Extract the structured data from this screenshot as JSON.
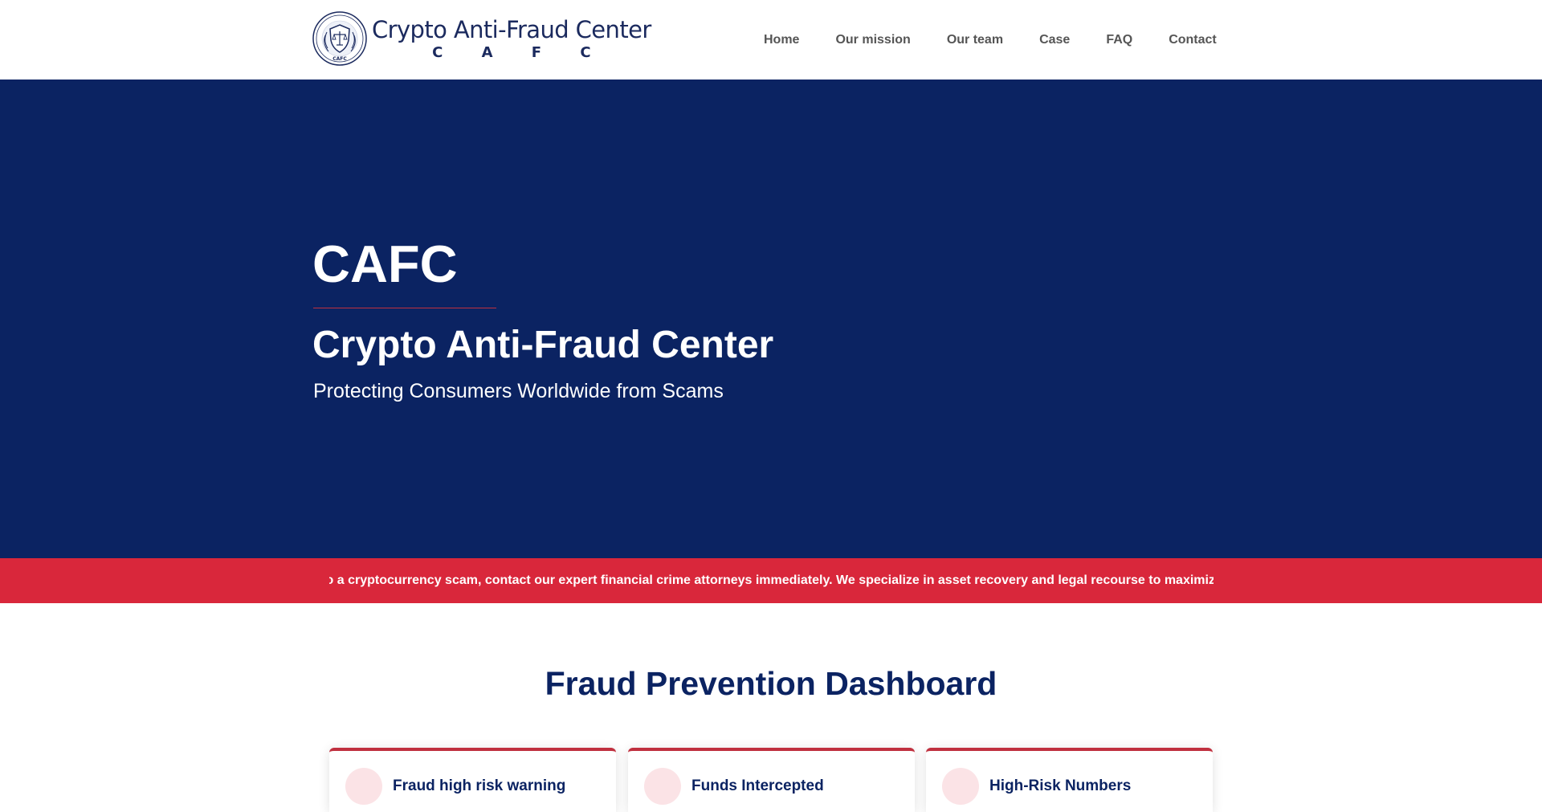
{
  "header": {
    "logo": {
      "title": "Crypto Anti-Fraud Center",
      "abbreviation": "C A F C",
      "seal_text": "CAFC"
    },
    "nav": [
      "Home",
      "Our mission",
      "Our team",
      "Case",
      "FAQ",
      "Contact"
    ]
  },
  "hero": {
    "title": "CAFC",
    "subtitle": "Crypto Anti-Fraud Center",
    "tagline": "Protecting Consumers Worldwide from Scams"
  },
  "ticker": {
    "text": "n to a cryptocurrency scam, contact our expert financial crime attorneys immediately. We specialize in asset recovery and legal recourse to maximize"
  },
  "dashboard": {
    "title": "Fraud Prevention Dashboard",
    "cards": [
      {
        "label": "Fraud high risk warning"
      },
      {
        "label": "Funds Intercepted"
      },
      {
        "label": "High-Risk Numbers"
      }
    ]
  },
  "colors": {
    "primary_navy": "#0b2362",
    "accent_red": "#d9273b",
    "nav_text": "#555555",
    "card_icon_bg": "#fbe3e6"
  }
}
